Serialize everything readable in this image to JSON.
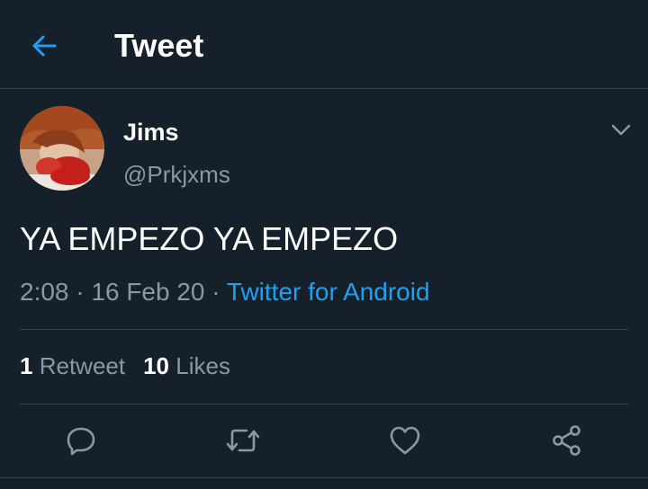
{
  "header": {
    "title": "Tweet",
    "back_icon": "arrow-left-icon",
    "accent_color": "#1da1f2"
  },
  "tweet": {
    "author": {
      "display_name": "Jims",
      "handle": "@Prkjxms",
      "avatar": "avatar-photo"
    },
    "text": "YA EMPEZO YA EMPEZO",
    "time": "2:08",
    "date": "16 Feb 20",
    "separator": "·",
    "source": "Twitter for Android"
  },
  "stats": {
    "retweets_count": "1",
    "retweets_label": "Retweet",
    "likes_count": "10",
    "likes_label": "Likes"
  },
  "actions": [
    {
      "name": "reply-icon"
    },
    {
      "name": "retweet-icon"
    },
    {
      "name": "like-icon"
    },
    {
      "name": "share-icon"
    }
  ],
  "colors": {
    "background": "#15202b",
    "divider": "#38444d",
    "secondary_text": "#8899a6",
    "link": "#1da1f2"
  }
}
